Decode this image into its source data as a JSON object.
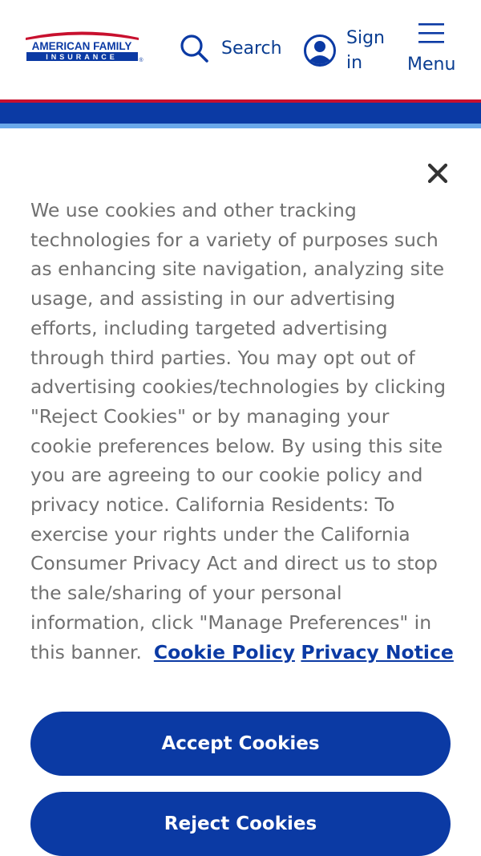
{
  "header": {
    "logo": {
      "line1": "AMERICAN FAMILY",
      "line2": "INSURANCE",
      "registered_mark": "®"
    },
    "search_label": "Search",
    "signin_label": "Sign in",
    "menu_label": "Menu"
  },
  "cookie_banner": {
    "close_icon": "close-icon",
    "body_text": "We use cookies and other tracking technologies for a variety of purposes such as enhancing site navigation, analyzing site usage, and assisting in our advertising efforts, including targeted advertising through third parties. You may opt out of advertising cookies/technologies by clicking \"Reject Cookies\" or by managing your cookie preferences below. By using this site you are agreeing to our cookie policy and privacy notice. California Residents: To exercise your rights under the California Consumer Privacy Act and direct us to stop the sale/sharing of your personal information, click \"Manage Preferences\" in this banner.",
    "cookie_policy_link": "Cookie Policy",
    "privacy_notice_link": "Privacy Notice",
    "accept_label": "Accept Cookies",
    "reject_label": "Reject Cookies"
  },
  "colors": {
    "brand_blue": "#0b3aa4",
    "brand_red": "#c8102e",
    "nav_text": "#0a3d91",
    "body_text": "#707070"
  }
}
